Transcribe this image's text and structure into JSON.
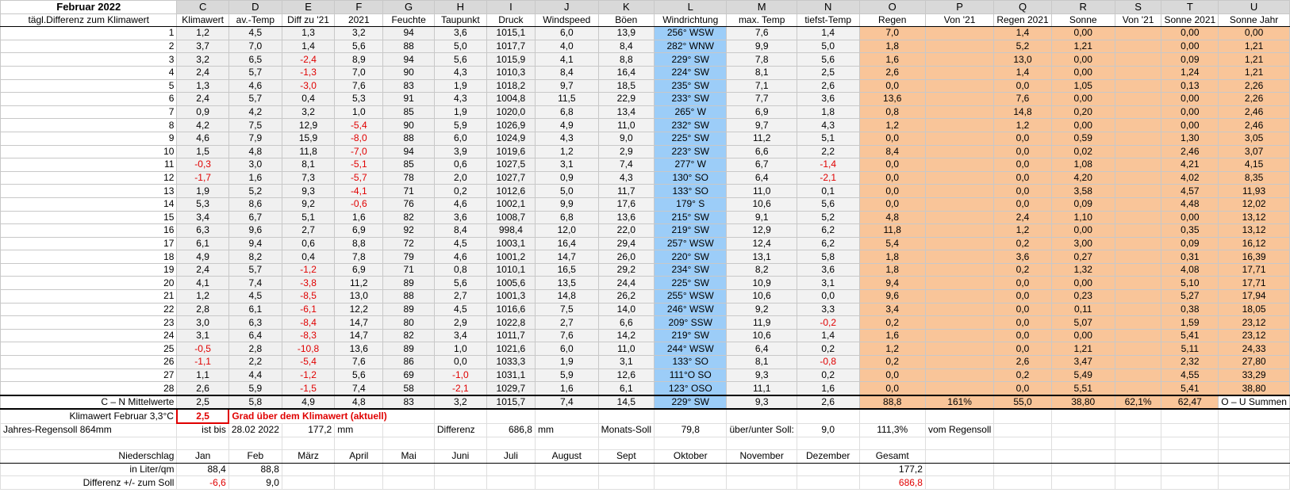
{
  "title": "Februar 2022",
  "col_letters": [
    "C",
    "D",
    "E",
    "F",
    "G",
    "H",
    "I",
    "J",
    "K",
    "L",
    "M",
    "N",
    "O",
    "P",
    "Q",
    "R",
    "S",
    "T",
    "U"
  ],
  "row_label_header": "tägl.Differenz zum Klimawert",
  "col_names": [
    "Klimawert",
    "av.-Temp",
    "Diff zu '21",
    "2021",
    "Feuchte",
    "Taupunkt",
    "Druck",
    "Windspeed",
    "Böen",
    "Windrichtung",
    "max. Temp",
    "tiefst-Temp",
    "Regen",
    "Von '21",
    "Regen 2021",
    "Sonne",
    "Von '21",
    "Sonne 2021",
    "Sonne Jahr"
  ],
  "rows": [
    [
      "1",
      "1,2",
      "4,5",
      "1,3",
      "3,2",
      "94",
      "3,6",
      "1015,1",
      "6,0",
      "13,9",
      "256° WSW",
      "7,6",
      "1,4",
      "7,0",
      "",
      "1,4",
      "0,00",
      "",
      "0,00",
      "0,00"
    ],
    [
      "2",
      "3,7",
      "7,0",
      "1,4",
      "5,6",
      "88",
      "5,0",
      "1017,7",
      "4,0",
      "8,4",
      "282° WNW",
      "9,9",
      "5,0",
      "1,8",
      "",
      "5,2",
      "1,21",
      "",
      "0,00",
      "1,21"
    ],
    [
      "3",
      "3,2",
      "6,5",
      "-2,4",
      "8,9",
      "94",
      "5,6",
      "1015,9",
      "4,1",
      "8,8",
      "229° SW",
      "7,8",
      "5,6",
      "1,6",
      "",
      "13,0",
      "0,00",
      "",
      "0,09",
      "1,21"
    ],
    [
      "4",
      "2,4",
      "5,7",
      "-1,3",
      "7,0",
      "90",
      "4,3",
      "1010,3",
      "8,4",
      "16,4",
      "224° SW",
      "8,1",
      "2,5",
      "2,6",
      "",
      "1,4",
      "0,00",
      "",
      "1,24",
      "1,21"
    ],
    [
      "5",
      "1,3",
      "4,6",
      "-3,0",
      "7,6",
      "83",
      "1,9",
      "1018,2",
      "9,7",
      "18,5",
      "235° SW",
      "7,1",
      "2,6",
      "0,0",
      "",
      "0,0",
      "1,05",
      "",
      "0,13",
      "2,26"
    ],
    [
      "6",
      "2,4",
      "5,7",
      "0,4",
      "5,3",
      "91",
      "4,3",
      "1004,8",
      "11,5",
      "22,9",
      "233° SW",
      "7,7",
      "3,6",
      "13,6",
      "",
      "7,6",
      "0,00",
      "",
      "0,00",
      "2,26"
    ],
    [
      "7",
      "0,9",
      "4,2",
      "3,2",
      "1,0",
      "85",
      "1,9",
      "1020,0",
      "6,8",
      "13,4",
      "265° W",
      "6,9",
      "1,8",
      "0,8",
      "",
      "14,8",
      "0,20",
      "",
      "0,00",
      "2,46"
    ],
    [
      "8",
      "4,2",
      "7,5",
      "12,9",
      "-5,4",
      "90",
      "5,9",
      "1026,9",
      "4,9",
      "11,0",
      "232° SW",
      "9,7",
      "4,3",
      "1,2",
      "",
      "1,2",
      "0,00",
      "",
      "0,00",
      "2,46"
    ],
    [
      "9",
      "4,6",
      "7,9",
      "15,9",
      "-8,0",
      "88",
      "6,0",
      "1024,9",
      "4,3",
      "9,0",
      "225° SW",
      "11,2",
      "5,1",
      "0,0",
      "",
      "0,0",
      "0,59",
      "",
      "1,30",
      "3,05"
    ],
    [
      "10",
      "1,5",
      "4,8",
      "11,8",
      "-7,0",
      "94",
      "3,9",
      "1019,6",
      "1,2",
      "2,9",
      "223° SW",
      "6,6",
      "2,2",
      "8,4",
      "",
      "0,0",
      "0,02",
      "",
      "2,46",
      "3,07"
    ],
    [
      "11",
      "-0,3",
      "3,0",
      "8,1",
      "-5,1",
      "85",
      "0,6",
      "1027,5",
      "3,1",
      "7,4",
      "277° W",
      "6,7",
      "-1,4",
      "0,0",
      "",
      "0,0",
      "1,08",
      "",
      "4,21",
      "4,15"
    ],
    [
      "12",
      "-1,7",
      "1,6",
      "7,3",
      "-5,7",
      "78",
      "2,0",
      "1027,7",
      "0,9",
      "4,3",
      "130° SO",
      "6,4",
      "-2,1",
      "0,0",
      "",
      "0,0",
      "4,20",
      "",
      "4,02",
      "8,35"
    ],
    [
      "13",
      "1,9",
      "5,2",
      "9,3",
      "-4,1",
      "71",
      "0,2",
      "1012,6",
      "5,0",
      "11,7",
      "133° SO",
      "11,0",
      "0,1",
      "0,0",
      "",
      "0,0",
      "3,58",
      "",
      "4,57",
      "11,93"
    ],
    [
      "14",
      "5,3",
      "8,6",
      "9,2",
      "-0,6",
      "76",
      "4,6",
      "1002,1",
      "9,9",
      "17,6",
      "179° S",
      "10,6",
      "5,6",
      "0,0",
      "",
      "0,0",
      "0,09",
      "",
      "4,48",
      "12,02"
    ],
    [
      "15",
      "3,4",
      "6,7",
      "5,1",
      "1,6",
      "82",
      "3,6",
      "1008,7",
      "6,8",
      "13,6",
      "215° SW",
      "9,1",
      "5,2",
      "4,8",
      "",
      "2,4",
      "1,10",
      "",
      "0,00",
      "13,12"
    ],
    [
      "16",
      "6,3",
      "9,6",
      "2,7",
      "6,9",
      "92",
      "8,4",
      "998,4",
      "12,0",
      "22,0",
      "219° SW",
      "12,9",
      "6,2",
      "11,8",
      "",
      "1,2",
      "0,00",
      "",
      "0,35",
      "13,12"
    ],
    [
      "17",
      "6,1",
      "9,4",
      "0,6",
      "8,8",
      "72",
      "4,5",
      "1003,1",
      "16,4",
      "29,4",
      "257° WSW",
      "12,4",
      "6,2",
      "5,4",
      "",
      "0,2",
      "3,00",
      "",
      "0,09",
      "16,12"
    ],
    [
      "18",
      "4,9",
      "8,2",
      "0,4",
      "7,8",
      "79",
      "4,6",
      "1001,2",
      "14,7",
      "26,0",
      "220° SW",
      "13,1",
      "5,8",
      "1,8",
      "",
      "3,6",
      "0,27",
      "",
      "0,31",
      "16,39"
    ],
    [
      "19",
      "2,4",
      "5,7",
      "-1,2",
      "6,9",
      "71",
      "0,8",
      "1010,1",
      "16,5",
      "29,2",
      "234° SW",
      "8,2",
      "3,6",
      "1,8",
      "",
      "0,2",
      "1,32",
      "",
      "4,08",
      "17,71"
    ],
    [
      "20",
      "4,1",
      "7,4",
      "-3,8",
      "11,2",
      "89",
      "5,6",
      "1005,6",
      "13,5",
      "24,4",
      "225° SW",
      "10,9",
      "3,1",
      "9,4",
      "",
      "0,0",
      "0,00",
      "",
      "5,10",
      "17,71"
    ],
    [
      "21",
      "1,2",
      "4,5",
      "-8,5",
      "13,0",
      "88",
      "2,7",
      "1001,3",
      "14,8",
      "26,2",
      "255° WSW",
      "10,6",
      "0,0",
      "9,6",
      "",
      "0,0",
      "0,23",
      "",
      "5,27",
      "17,94"
    ],
    [
      "22",
      "2,8",
      "6,1",
      "-6,1",
      "12,2",
      "89",
      "4,5",
      "1016,6",
      "7,5",
      "14,0",
      "246° WSW",
      "9,2",
      "3,3",
      "3,4",
      "",
      "0,0",
      "0,11",
      "",
      "0,38",
      "18,05"
    ],
    [
      "23",
      "3,0",
      "6,3",
      "-8,4",
      "14,7",
      "80",
      "2,9",
      "1022,8",
      "2,7",
      "6,6",
      "209° SSW",
      "11,9",
      "-0,2",
      "0,2",
      "",
      "0,0",
      "5,07",
      "",
      "1,59",
      "23,12"
    ],
    [
      "24",
      "3,1",
      "6,4",
      "-8,3",
      "14,7",
      "82",
      "3,4",
      "1011,7",
      "7,6",
      "14,2",
      "219° SW",
      "10,6",
      "1,4",
      "1,6",
      "",
      "0,0",
      "0,00",
      "",
      "5,41",
      "23,12"
    ],
    [
      "25",
      "-0,5",
      "2,8",
      "-10,8",
      "13,6",
      "89",
      "1,0",
      "1021,6",
      "6,0",
      "11,0",
      "244° WSW",
      "6,4",
      "0,2",
      "1,2",
      "",
      "0,0",
      "1,21",
      "",
      "5,11",
      "24,33"
    ],
    [
      "26",
      "-1,1",
      "2,2",
      "-5,4",
      "7,6",
      "86",
      "0,0",
      "1033,3",
      "1,9",
      "3,1",
      "133° SO",
      "8,1",
      "-0,8",
      "0,2",
      "",
      "2,6",
      "3,47",
      "",
      "2,32",
      "27,80"
    ],
    [
      "27",
      "1,1",
      "4,4",
      "-1,2",
      "5,6",
      "69",
      "-1,0",
      "1031,1",
      "5,9",
      "12,6",
      "111°O SO",
      "9,3",
      "0,2",
      "0,0",
      "",
      "0,2",
      "5,49",
      "",
      "4,55",
      "33,29"
    ],
    [
      "28",
      "2,6",
      "5,9",
      "-1,5",
      "7,4",
      "58",
      "-2,1",
      "1029,7",
      "1,6",
      "6,1",
      "123° OSO",
      "11,1",
      "1,6",
      "0,0",
      "",
      "0,0",
      "5,51",
      "",
      "5,41",
      "38,80"
    ]
  ],
  "mittel": {
    "label": "C – N Mittelwerte",
    "values": [
      "2,5",
      "5,8",
      "4,9",
      "4,8",
      "83",
      "3,2",
      "1015,7",
      "7,4",
      "14,5",
      "229° SW",
      "9,3",
      "2,6",
      "88,8",
      "161%",
      "55,0",
      "38,80",
      "62,1%",
      "62,47",
      "O – U Summen"
    ]
  },
  "klima": {
    "label": "Klimawert Februar 3,3°C",
    "value": "2,5",
    "text": "Grad über dem Klimawert (aktuell)"
  },
  "jahres": {
    "label": "Jahres-Regensoll 864mm",
    "bis": "ist bis",
    "date": "28.02 2022",
    "amount": "177,2",
    "unit": "mm",
    "diff_label": "Differenz",
    "diff": "686,8",
    "diff_unit": "mm",
    "monats_label": "Monats-Soll",
    "monats": "79,8",
    "ueber_label": "über/unter Soll:",
    "ueber": "9,0",
    "pct": "111,3%",
    "vom": "vom Regensoll"
  },
  "nieder": {
    "label": "Niederschlag",
    "months": [
      "Jan",
      "Feb",
      "März",
      "April",
      "Mai",
      "Juni",
      "Juli",
      "August",
      "Sept",
      "Oktober",
      "November",
      "Dezember",
      "Gesamt"
    ]
  },
  "liter": {
    "label": "in Liter/qm",
    "values": [
      "88,4",
      "88,8",
      "",
      "",
      "",
      "",
      "",
      "",
      "",
      "",
      "",
      "",
      "177,2"
    ]
  },
  "diffsoll": {
    "label": "Differenz  +/- zum Soll",
    "values": [
      "-6,6",
      "9,0",
      "",
      "",
      "",
      "",
      "",
      "",
      "",
      "",
      "",
      "",
      "686,8"
    ]
  }
}
